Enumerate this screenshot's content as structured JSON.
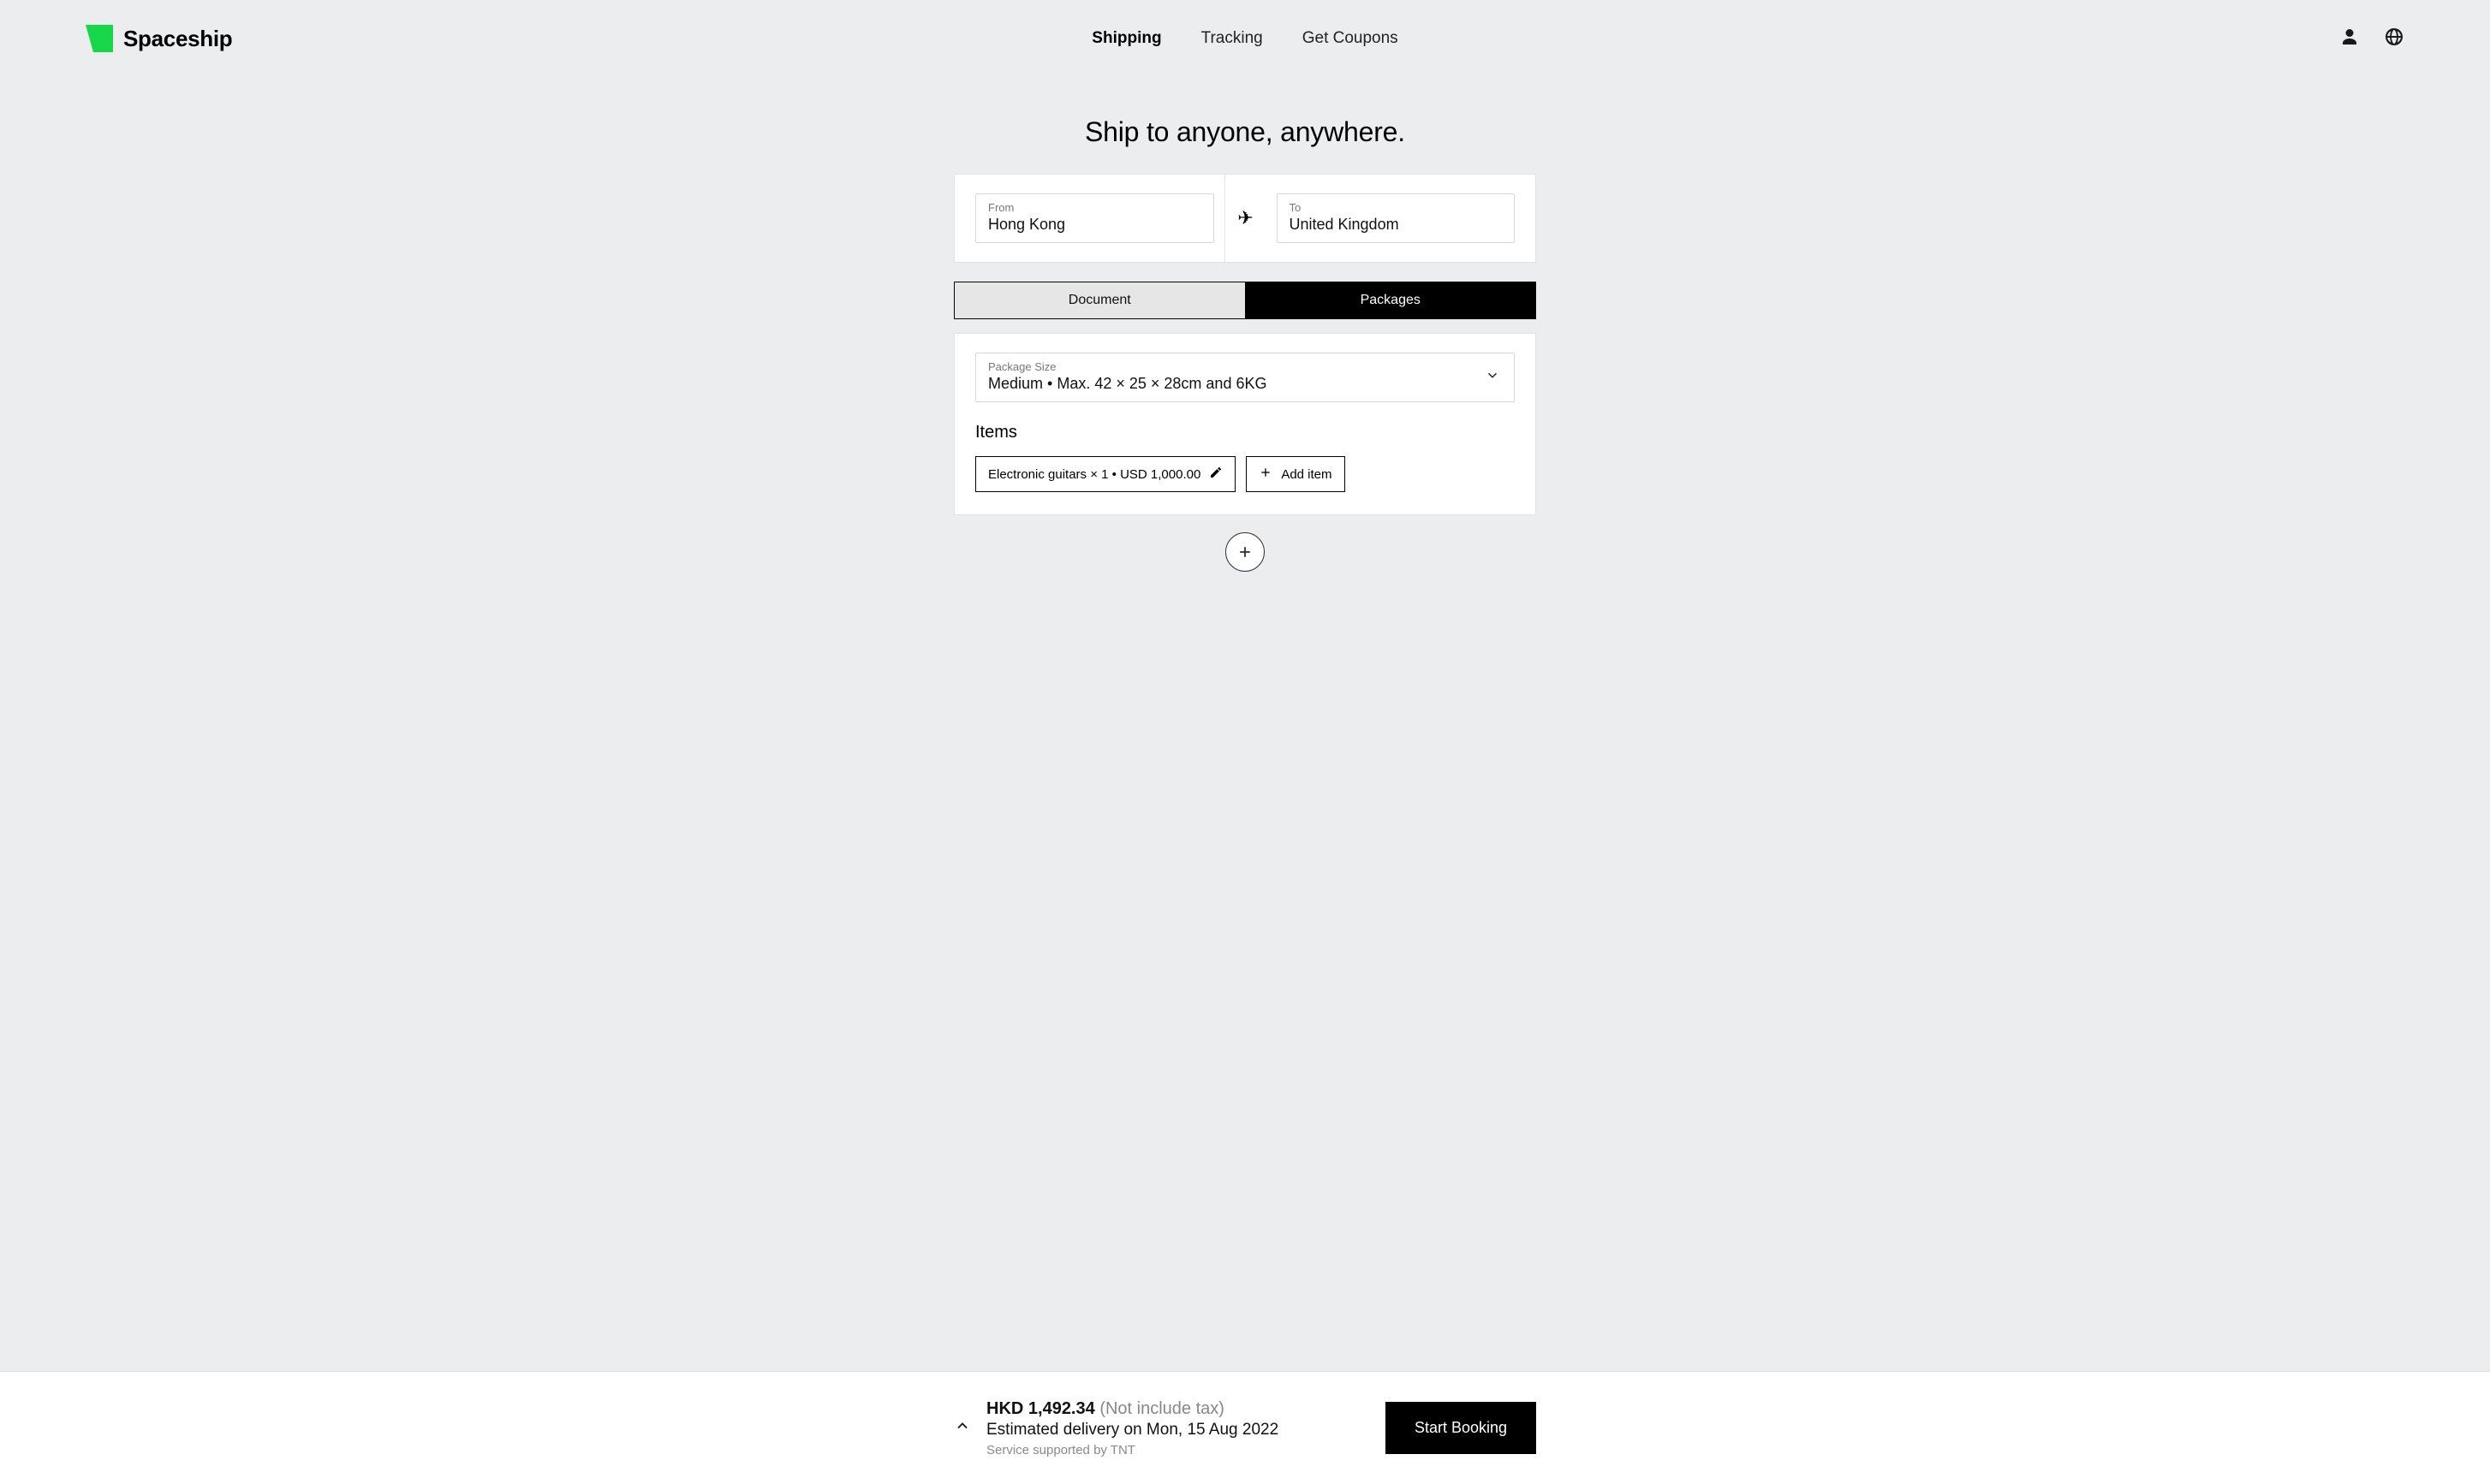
{
  "brand": {
    "name": "Spaceship"
  },
  "nav": {
    "links": [
      {
        "label": "Shipping",
        "active": true
      },
      {
        "label": "Tracking",
        "active": false
      },
      {
        "label": "Get Coupons",
        "active": false
      }
    ]
  },
  "hero": {
    "title": "Ship to anyone, anywhere."
  },
  "route": {
    "from_label": "From",
    "from_value": "Hong Kong",
    "to_label": "To",
    "to_value": "United Kingdom"
  },
  "shipment_type": {
    "options": [
      {
        "label": "Document",
        "active": false
      },
      {
        "label": "Packages",
        "active": true
      }
    ]
  },
  "package": {
    "size_label": "Package Size",
    "size_value": "Medium • Max. 42 × 25 × 28cm and 6KG",
    "items_label": "Items",
    "items": [
      {
        "summary": "Electronic guitars × 1 • USD 1,000.00"
      }
    ],
    "add_item_label": "Add item"
  },
  "quote": {
    "price": "HKD 1,492.34",
    "tax_note": "(Not include tax)",
    "eta": "Estimated delivery on Mon, 15 Aug 2022",
    "provider": "Service supported by TNT",
    "cta": "Start Booking"
  }
}
